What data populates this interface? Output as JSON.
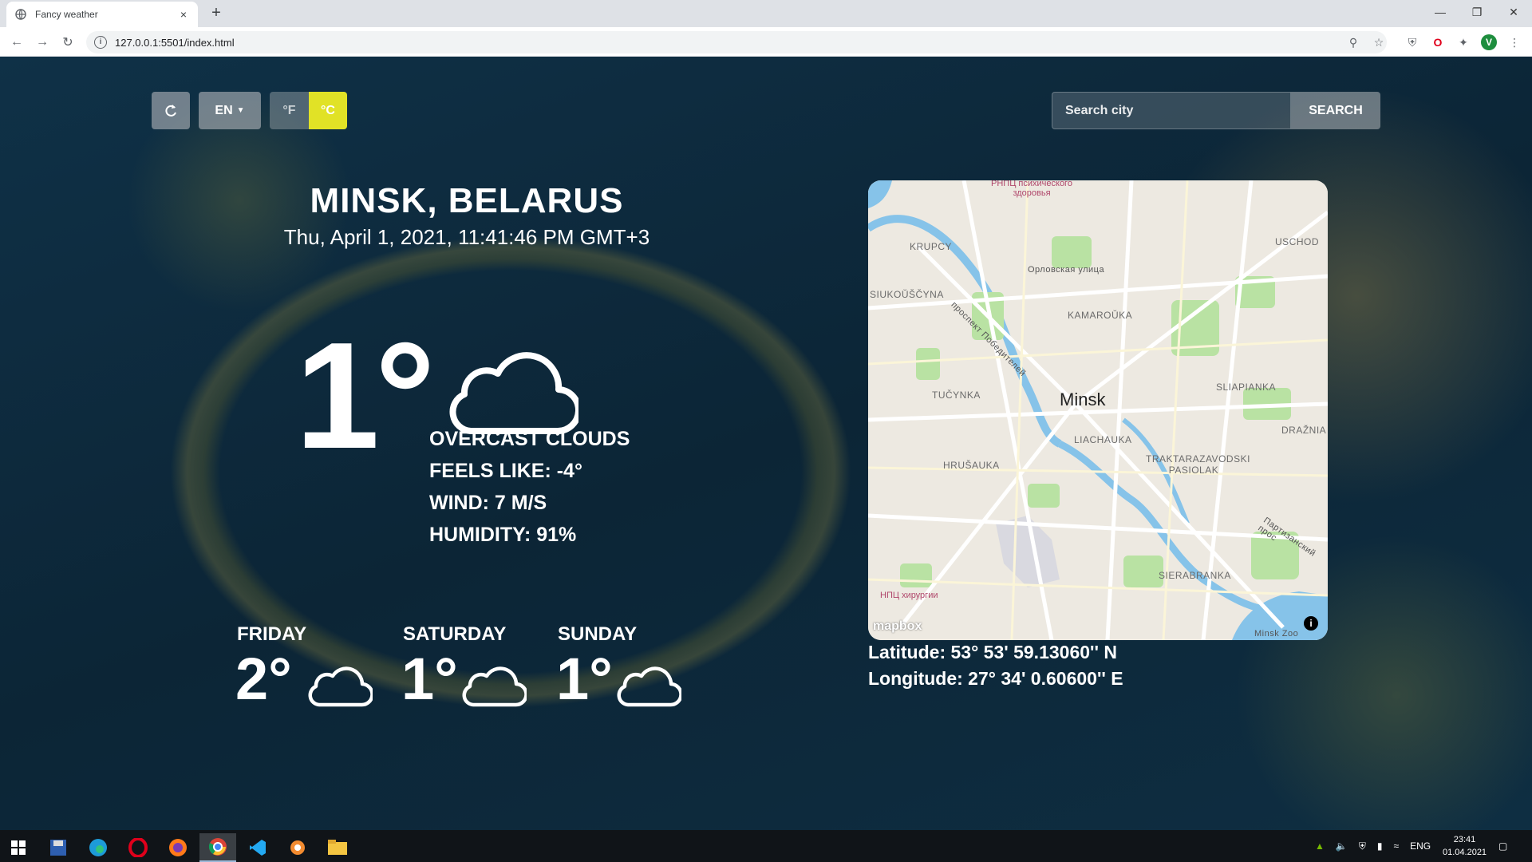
{
  "browser": {
    "tab_title": "Fancy weather",
    "tab_close": "×",
    "new_tab": "+",
    "url": "127.0.0.1:5501/index.html"
  },
  "controls": {
    "lang": "EN",
    "unit_f": "°F",
    "unit_c": "°C",
    "search_placeholder": "Search city",
    "search_label": "SEARCH"
  },
  "location": {
    "city": "MINSK, BELARUS",
    "datetime": "Thu, April 1, 2021, 11:41:46 PM GMT+3"
  },
  "current": {
    "temp": "1°",
    "condition": "OVERCAST CLOUDS",
    "feels_like": "FEELS LIKE: -4°",
    "wind": "WIND: 7 M/S",
    "humidity": "HUMIDITY: 91%",
    "icon": "cloud-icon"
  },
  "forecast": [
    {
      "day": "FRIDAY",
      "temp": "2°",
      "icon": "cloud-icon"
    },
    {
      "day": "SATURDAY",
      "temp": "1°",
      "icon": "cloud-icon"
    },
    {
      "day": "SUNDAY",
      "temp": "1°",
      "icon": "cloud-icon"
    }
  ],
  "map": {
    "city_label": "Minsk",
    "districts": [
      "KRUPCY",
      "USCHOD",
      "SIUKOŬŠČYNA",
      "KAMAROŬKA",
      "TUČYNKA",
      "SLIAPIANKA",
      "LIACHAUKA",
      "DRAŽNIA",
      "HRUŠAUKA",
      "TRAKTARAZAVODSKI PASIOLAK",
      "SIERABRANKA"
    ],
    "streets": [
      "Орловская улица",
      "проспект Победителей",
      "Партизанский прос"
    ],
    "pois": [
      "РНПЦ психического здоровья",
      "НПЦ хирургии",
      "Minsk Zoo"
    ],
    "attribution": "mapbox",
    "info": "i"
  },
  "coords": {
    "latitude": "Latitude: 53° 53' 59.13060'' N",
    "longitude": "Longitude: 27° 34' 0.60600'' E"
  },
  "taskbar": {
    "lang": "ENG",
    "time": "23:41",
    "date": "01.04.2021"
  }
}
